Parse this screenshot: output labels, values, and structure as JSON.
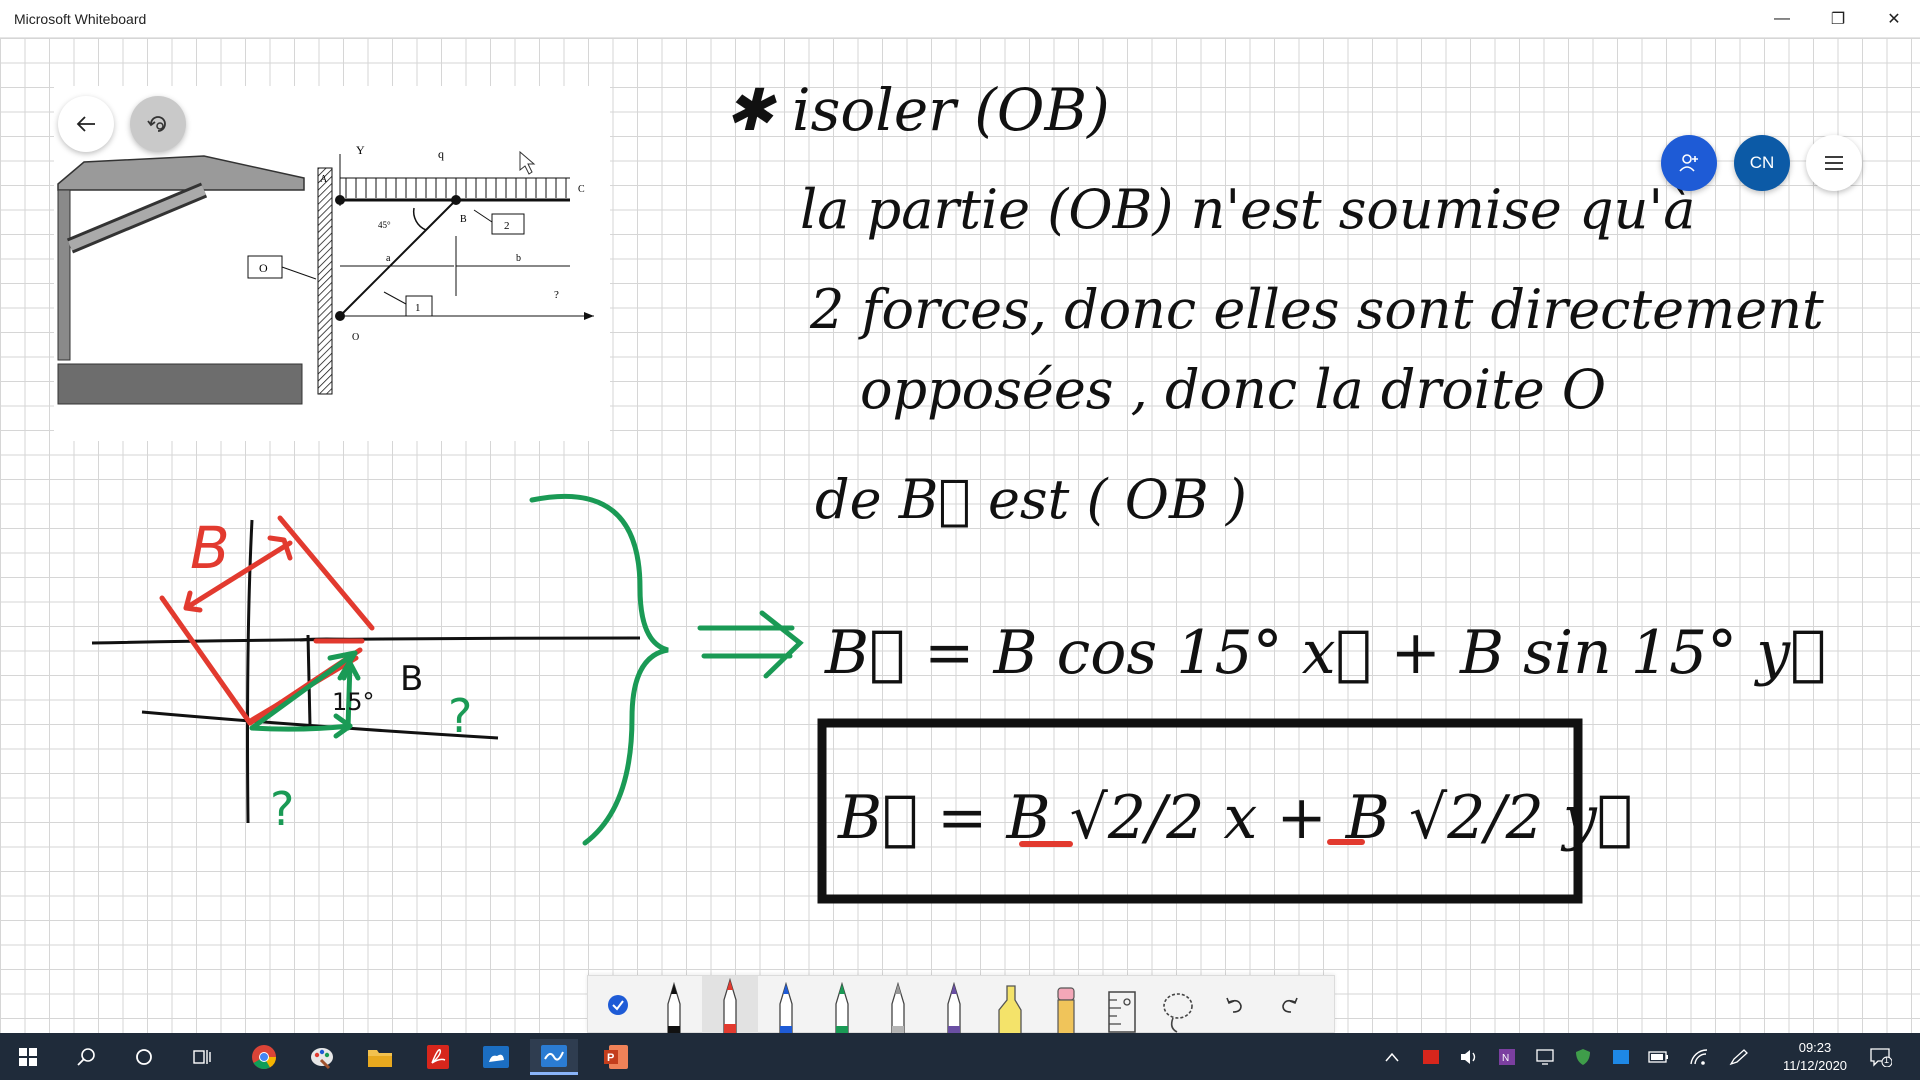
{
  "window": {
    "title": "Microsoft Whiteboard",
    "minimize_glyph": "—",
    "restore_glyph": "❐",
    "close_glyph": "✕"
  },
  "floating_buttons": {
    "back": "arrow-left-icon",
    "rotate": "rotate-icon",
    "invite": "add-person-icon",
    "account_initials": "CN",
    "menu": "hamburger-icon"
  },
  "image_diagram": {
    "labels": {
      "y_axis": "Y",
      "load": "q",
      "point_a": "A",
      "point_b": "B",
      "point_c": "C",
      "point_o": "O",
      "angle": "45°",
      "dim_a": "a",
      "dim_b": "b",
      "box_1": "1",
      "box_2": "2",
      "box_o": "O",
      "question": "?"
    }
  },
  "handwriting": {
    "line1": "✱   isoler  (OB)",
    "line2": "la partie (OB) n'est soumise qu'à",
    "line3": "2 forces, donc elles sont directement",
    "line4": "opposées , donc la droite O",
    "line5": "de  B⃗  est ( OB )",
    "eq1": "B⃗  =  B cos 15°  x⃗  +  B sin 15°  y⃗",
    "eq2": "B⃗  =  B √2/2  x  +  B √2/2  y⃗",
    "sketch_label_b": "B",
    "sketch_label_15": "15°",
    "sketch_label_b2": "B",
    "sketch_q1": "?",
    "sketch_q2": "?"
  },
  "colors": {
    "ink_black": "#111111",
    "ink_red": "#e23a2f",
    "ink_green": "#1a9a55",
    "accent_blue": "#1e5bd6",
    "account_blue": "#0c5aa6"
  },
  "pen_toolbar": {
    "tools": [
      "ink-checkmark-icon",
      "black-pen-icon",
      "red-pen-icon",
      "blue-pen-icon",
      "green-pen-icon",
      "grey-pen-icon",
      "purple-pen-icon",
      "highlighter-icon",
      "eraser-icon",
      "ruler-icon",
      "lasso-icon",
      "undo-icon",
      "redo-icon"
    ],
    "selected": "red-pen-icon"
  },
  "taskbar": {
    "apps": [
      "windows-start-icon",
      "search-icon",
      "cortana-icon",
      "task-view-icon",
      "chrome-icon",
      "paint-icon",
      "file-explorer-icon",
      "acrobat-icon",
      "onedrive-icon",
      "whiteboard-icon",
      "powerpoint-icon"
    ],
    "active": "whiteboard-icon",
    "time": "09:23",
    "date": "11/12/2020",
    "notifications_count": "1"
  }
}
